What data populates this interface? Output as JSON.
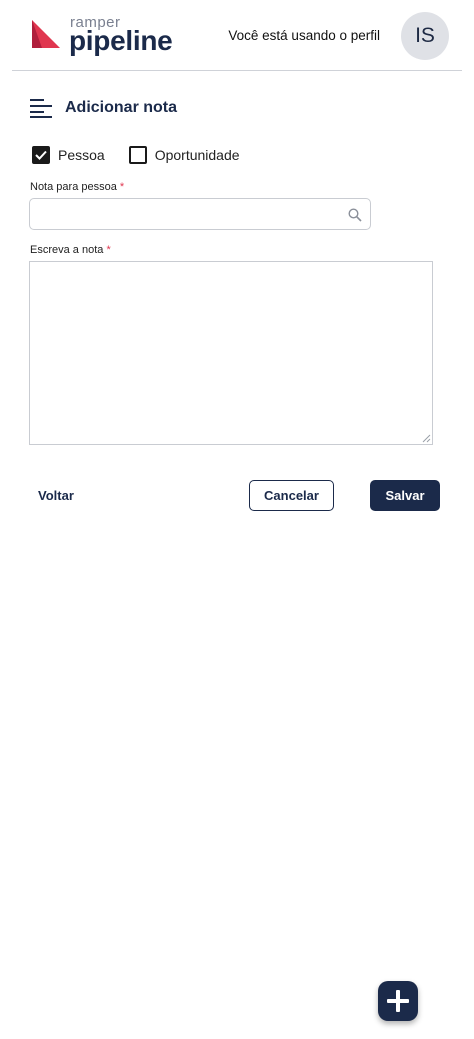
{
  "header": {
    "logo_small": "ramper",
    "logo_big": "pipeline",
    "profile_text": "Você está usando o perfil",
    "avatar_initials": "IS"
  },
  "page": {
    "title": "Adicionar nota"
  },
  "options": [
    {
      "label": "Pessoa",
      "checked": true
    },
    {
      "label": "Oportunidade",
      "checked": false
    }
  ],
  "fields": {
    "person_label": "Nota para pessoa",
    "person_value": "",
    "note_label": "Escreva a nota",
    "note_value": "",
    "required_mark": "*"
  },
  "actions": {
    "back": "Voltar",
    "cancel": "Cancelar",
    "save": "Salvar"
  },
  "icons": {
    "menu": "menu-lines-icon",
    "search": "search-icon",
    "fab": "plus-icon"
  },
  "colors": {
    "brand_navy": "#1b2a4a",
    "brand_pink": "#e0364f",
    "avatar_bg": "#dfe1e6"
  }
}
